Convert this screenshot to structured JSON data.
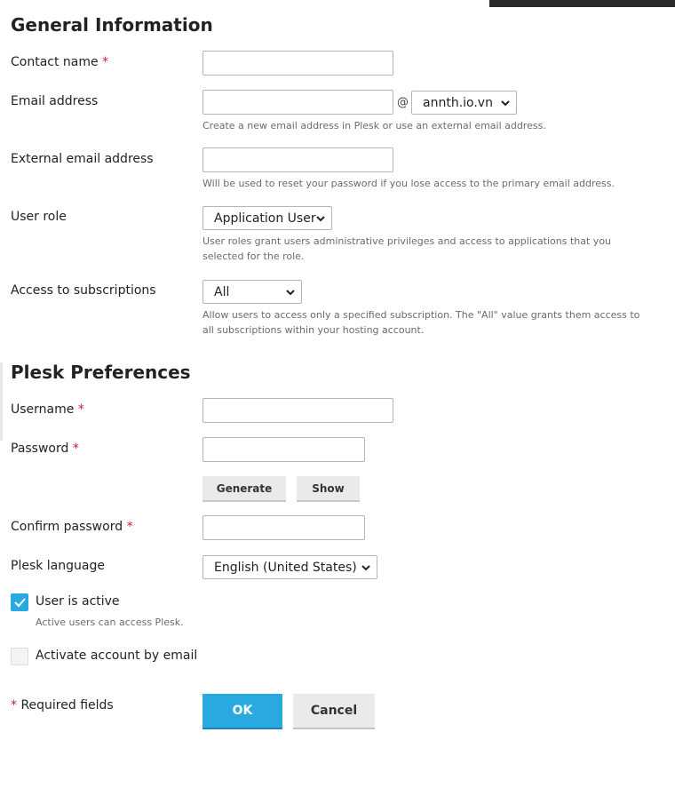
{
  "general": {
    "title": "General Information",
    "contact_name": {
      "label": "Contact name",
      "required": "*",
      "value": ""
    },
    "email": {
      "label": "Email address",
      "value": "",
      "at": "@",
      "domain": "annth.io.vn",
      "hint": "Create a new email address in Plesk or use an external email address."
    },
    "external_email": {
      "label": "External email address",
      "value": "",
      "hint": "Will be used to reset your password if you lose access to the primary email address."
    },
    "user_role": {
      "label": "User role",
      "selected": "Application User",
      "hint": "User roles grant users administrative privileges and access to applications that you selected for the role."
    },
    "subscriptions": {
      "label": "Access to subscriptions",
      "selected": "All",
      "hint": "Allow users to access only a specified subscription. The \"All\" value grants them access to all subscriptions within your hosting account."
    }
  },
  "prefs": {
    "title": "Plesk Preferences",
    "username": {
      "label": "Username",
      "required": "*",
      "value": ""
    },
    "password": {
      "label": "Password",
      "required": "*",
      "value": ""
    },
    "generate_label": "Generate",
    "show_label": "Show",
    "confirm": {
      "label": "Confirm password",
      "required": "*",
      "value": ""
    },
    "language": {
      "label": "Plesk language",
      "selected": "English (United States)"
    },
    "active": {
      "label": "User is active",
      "checked": true,
      "hint": "Active users can access Plesk."
    },
    "activate_email": {
      "label": "Activate account by email",
      "checked": false
    }
  },
  "footer": {
    "required_mark": "*",
    "required_text": " Required fields",
    "ok_label": "OK",
    "cancel_label": "Cancel"
  },
  "colors": {
    "accent": "#28aae1",
    "required": "#c8202c"
  },
  "icons": {
    "select_arrow": "chevron-down-icon",
    "check": "checkmark-icon"
  }
}
